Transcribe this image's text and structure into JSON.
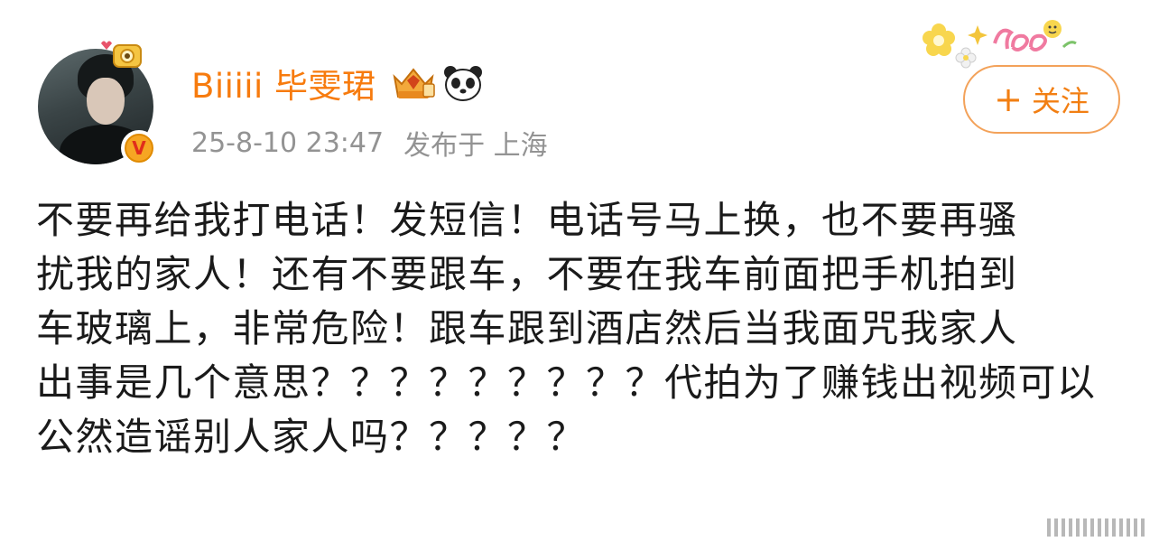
{
  "post": {
    "author": {
      "name": "Biiiii 毕雯珺",
      "verified": true,
      "verified_color": "#f6a623"
    },
    "timestamp": "25-8-10 23:47",
    "location": "发布于 上海",
    "follow_button": {
      "plus": "+",
      "label": "关注"
    },
    "text_lines": [
      "不要再给我打电话！发短信！电话号马上换，也不要再骚",
      "扰我的家人！还有不要跟车，不要在我车前面把手机拍到",
      "车玻璃上，非常危险！跟车跟到酒店然后当我面咒我家人",
      "出事是几个意思？？？？？？？？？代拍为了赚钱出视频可以",
      "公然造谣别人家人吗？？？？？"
    ],
    "colors": {
      "username": "#f77b0e",
      "follow_border": "#f3a25a",
      "meta": "#939393",
      "text": "#1a1a1a"
    },
    "icons": [
      "crown-badge-icon",
      "panda-icon",
      "verified-v-icon",
      "flower-deco-icon"
    ]
  }
}
